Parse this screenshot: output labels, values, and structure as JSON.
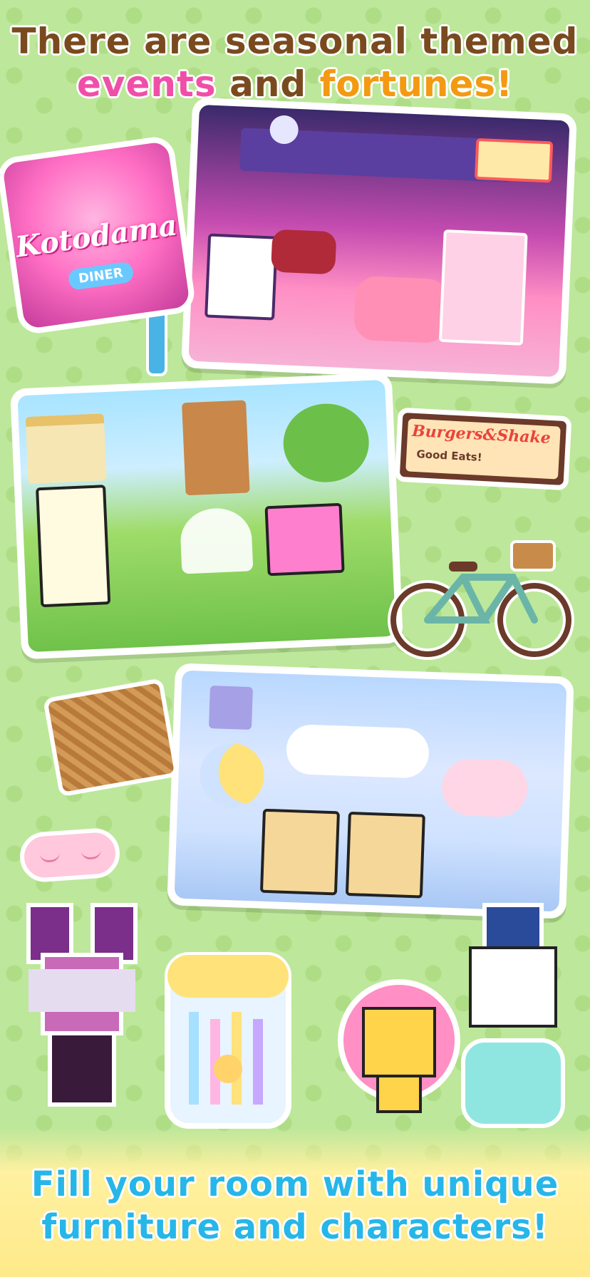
{
  "headline": {
    "line1": "There are seasonal themed",
    "line2_part1": "events",
    "line2_part2": "and",
    "line2_part3": "fortunes!"
  },
  "signs": {
    "diner_title": "Kotodama",
    "diner_sub": "DINER",
    "burger_title": "Burgers&Shake",
    "burger_sub": "Good Eats!"
  },
  "footer": {
    "line1": "Fill your room with unique",
    "line2": "furniture and characters!"
  },
  "colors": {
    "background": "#bde79a",
    "headline_brown": "#7a4a1f",
    "headline_pink": "#f04fa8",
    "headline_orange": "#f39a12",
    "footer_blue": "#27b6e8"
  }
}
